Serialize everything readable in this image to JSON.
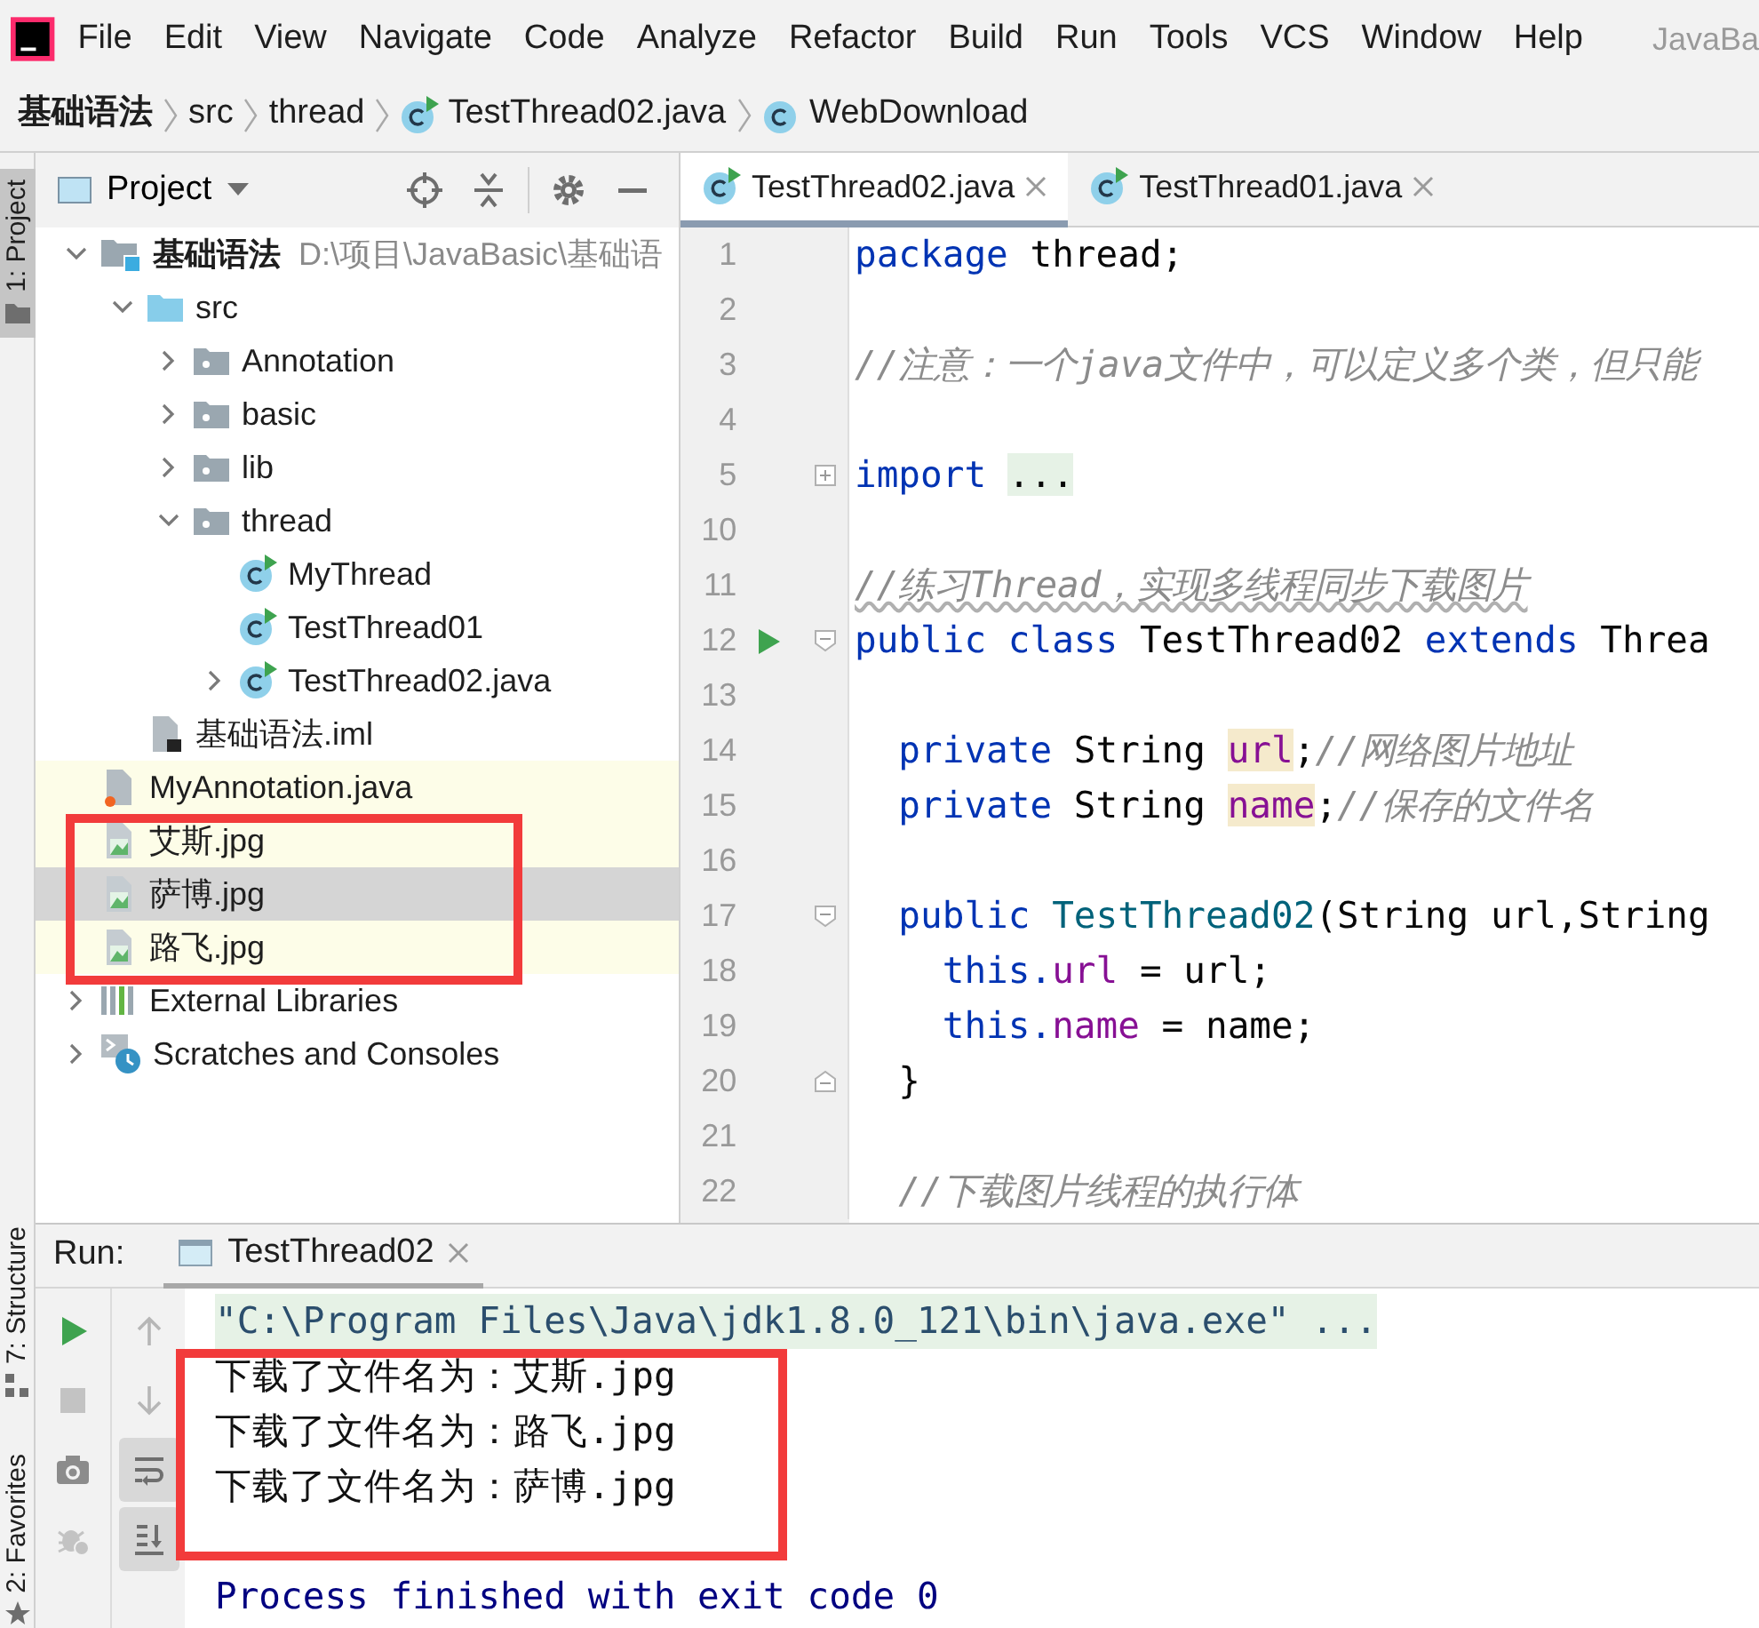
{
  "menu_bar": {
    "items": [
      "File",
      "Edit",
      "View",
      "Navigate",
      "Code",
      "Analyze",
      "Refactor",
      "Build",
      "Run",
      "Tools",
      "VCS",
      "Window",
      "Help"
    ],
    "title": "JavaBa"
  },
  "breadcrumbs": [
    {
      "label": "基础语法",
      "kind": "module"
    },
    {
      "label": "src",
      "kind": "folder"
    },
    {
      "label": "thread",
      "kind": "folder"
    },
    {
      "label": "TestThread02.java",
      "kind": "runnable-class"
    },
    {
      "label": "WebDownload",
      "kind": "class"
    }
  ],
  "left_stripe": {
    "top": [
      {
        "label": "1: Project",
        "selected": true,
        "kind": "project"
      }
    ],
    "bottom": [
      {
        "label": "7: Structure",
        "selected": false,
        "kind": "structure"
      },
      {
        "label": "2: Favorites",
        "selected": false,
        "kind": "favorites"
      }
    ]
  },
  "project_panel": {
    "title": "Project",
    "tree": [
      {
        "label": "基础语法",
        "detail": "D:\\项目\\JavaBasic\\基础语",
        "kind": "module",
        "expanded": true,
        "selected": false,
        "non_project": false,
        "outlined": false,
        "children": [
          {
            "label": "src",
            "kind": "source-folder",
            "expanded": true,
            "selected": false,
            "non_project": false,
            "outlined": false,
            "children": [
              {
                "label": "Annotation",
                "kind": "package",
                "expanded": false,
                "selected": false,
                "non_project": false,
                "outlined": false
              },
              {
                "label": "basic",
                "kind": "package",
                "expanded": false,
                "selected": false,
                "non_project": false,
                "outlined": false
              },
              {
                "label": "lib",
                "kind": "package",
                "expanded": false,
                "selected": false,
                "non_project": false,
                "outlined": false
              },
              {
                "label": "thread",
                "kind": "package",
                "expanded": true,
                "selected": false,
                "non_project": false,
                "outlined": false,
                "children": [
                  {
                    "label": "MyThread",
                    "kind": "runnable-class",
                    "selected": false,
                    "non_project": false,
                    "outlined": false
                  },
                  {
                    "label": "TestThread01",
                    "kind": "runnable-class",
                    "selected": false,
                    "non_project": false,
                    "outlined": false
                  },
                  {
                    "label": "TestThread02.java",
                    "kind": "runnable-class",
                    "expanded": false,
                    "selected": false,
                    "non_project": false,
                    "outlined": false
                  }
                ]
              }
            ]
          },
          {
            "label": "基础语法.iml",
            "kind": "iml",
            "selected": false,
            "non_project": false,
            "outlined": false
          }
        ]
      },
      {
        "label": "MyAnnotation.java",
        "kind": "java-file",
        "selected": false,
        "non_project": true,
        "outlined": false
      },
      {
        "label": "艾斯.jpg",
        "kind": "image",
        "selected": false,
        "non_project": true,
        "outlined": true
      },
      {
        "label": "萨博.jpg",
        "kind": "image",
        "selected": true,
        "non_project": true,
        "outlined": true
      },
      {
        "label": "路飞.jpg",
        "kind": "image",
        "selected": false,
        "non_project": true,
        "outlined": true
      },
      {
        "label": "External Libraries",
        "kind": "libraries",
        "expanded": false,
        "selected": false,
        "non_project": false,
        "outlined": false
      },
      {
        "label": "Scratches and Consoles",
        "kind": "scratches",
        "expanded": false,
        "selected": false,
        "non_project": false,
        "outlined": false
      }
    ]
  },
  "editor": {
    "tabs": [
      {
        "label": "TestThread02.java",
        "selected": true
      },
      {
        "label": "TestThread01.java",
        "selected": false
      }
    ],
    "lines": [
      {
        "number": "1",
        "tokens": [
          {
            "kind": "keyword",
            "text": "package"
          },
          {
            "kind": "plain",
            "text": " thread;"
          }
        ]
      },
      {
        "number": "2"
      },
      {
        "number": "3",
        "tokens": [
          {
            "kind": "comment",
            "text": "//注意：一个java文件中，可以定义多个类，但只能",
            "misspelled": false
          }
        ]
      },
      {
        "number": "4"
      },
      {
        "number": "5",
        "fold": {
          "kind": "expand"
        },
        "tokens": [
          {
            "kind": "keyword",
            "text": "import "
          },
          {
            "kind": "folded",
            "text": "..."
          }
        ]
      },
      {
        "number": "10"
      },
      {
        "number": "11",
        "tokens": [
          {
            "kind": "comment",
            "text": "//练习Thread，实现多线程同步下载图片",
            "misspelled": true
          }
        ]
      },
      {
        "number": "12",
        "run_marker": true,
        "fold": {
          "kind": "start"
        },
        "tokens": [
          {
            "kind": "keyword",
            "text": "public class"
          },
          {
            "kind": "plain",
            "text": " TestThread02 "
          },
          {
            "kind": "keyword",
            "text": "extends"
          },
          {
            "kind": "plain",
            "text": " Threa"
          }
        ]
      },
      {
        "number": "13"
      },
      {
        "number": "14",
        "tokens": [
          {
            "kind": "keyword",
            "text": "  private"
          },
          {
            "kind": "plain",
            "text": " String "
          },
          {
            "kind": "field",
            "text": "url",
            "highlighted": true
          },
          {
            "kind": "plain",
            "text": ";"
          },
          {
            "kind": "comment",
            "text": "//网络图片地址",
            "misspelled": false
          }
        ]
      },
      {
        "number": "15",
        "tokens": [
          {
            "kind": "keyword",
            "text": "  private"
          },
          {
            "kind": "plain",
            "text": " String "
          },
          {
            "kind": "field",
            "text": "name",
            "highlighted": true
          },
          {
            "kind": "plain",
            "text": ";"
          },
          {
            "kind": "comment",
            "text": "//保存的文件名",
            "misspelled": false
          }
        ]
      },
      {
        "number": "16"
      },
      {
        "number": "17",
        "fold": {
          "kind": "start"
        },
        "tokens": [
          {
            "kind": "keyword",
            "text": "  public "
          },
          {
            "kind": "declaration",
            "text": "TestThread02"
          },
          {
            "kind": "plain",
            "text": "(String url,String"
          }
        ]
      },
      {
        "number": "18",
        "tokens": [
          {
            "kind": "keyword",
            "text": "    this."
          },
          {
            "kind": "field",
            "text": "url",
            "highlighted": false
          },
          {
            "kind": "plain",
            "text": " = url;"
          }
        ]
      },
      {
        "number": "19",
        "tokens": [
          {
            "kind": "keyword",
            "text": "    this."
          },
          {
            "kind": "field",
            "text": "name",
            "highlighted": false
          },
          {
            "kind": "plain",
            "text": " = name;"
          }
        ]
      },
      {
        "number": "20",
        "fold": {
          "kind": "end"
        },
        "tokens": [
          {
            "kind": "plain",
            "text": "  }"
          }
        ]
      },
      {
        "number": "21"
      },
      {
        "number": "22",
        "tokens": [
          {
            "kind": "comment",
            "text": "  //下载图片线程的执行体",
            "misspelled": false
          }
        ]
      }
    ]
  },
  "run_panel": {
    "label": "Run:",
    "tabs": [
      {
        "label": "TestThread02",
        "selected": true
      }
    ],
    "left_toolbar": [
      {
        "kind": "run",
        "disabled": false
      },
      {
        "kind": "stop",
        "disabled": true
      },
      {
        "kind": "screenshot",
        "disabled": false
      },
      {
        "kind": "debug",
        "disabled": true
      }
    ],
    "right_toolbar": [
      {
        "kind": "up",
        "disabled": true,
        "on": false
      },
      {
        "kind": "down",
        "disabled": true,
        "on": false
      },
      {
        "kind": "soft-wrap",
        "disabled": false,
        "on": true
      },
      {
        "kind": "scroll-end",
        "disabled": false,
        "on": true
      }
    ],
    "output": [
      {
        "kind": "command",
        "text": "\"C:\\Program Files\\Java\\jdk1.8.0_121\\bin\\java.exe\" ...",
        "outlined": false
      },
      {
        "kind": "stdout",
        "text": "下载了文件名为：艾斯.jpg",
        "outlined": true
      },
      {
        "kind": "stdout",
        "text": "下载了文件名为：路飞.jpg",
        "outlined": true
      },
      {
        "kind": "stdout",
        "text": "下载了文件名为：萨博.jpg",
        "outlined": true
      },
      {
        "kind": "exit",
        "text": "Process finished with exit code 0",
        "outlined": false
      }
    ]
  }
}
